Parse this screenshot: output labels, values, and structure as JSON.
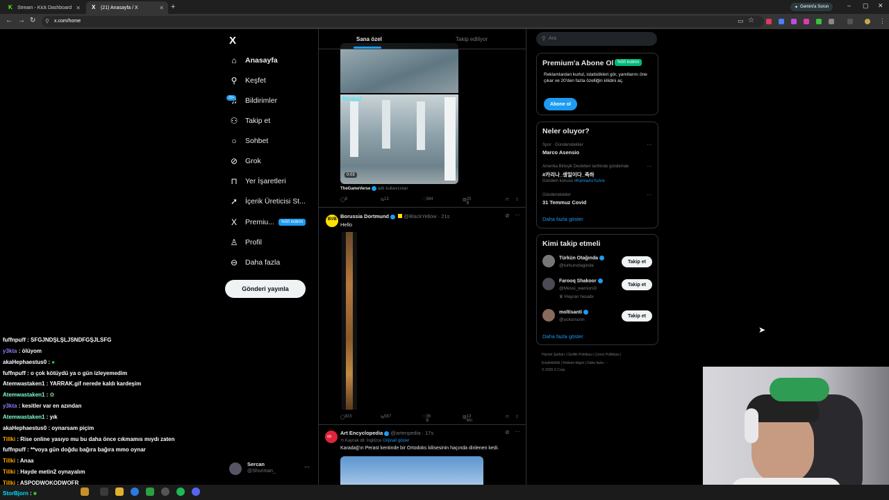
{
  "browser": {
    "tabs": [
      {
        "title": "Stream - Kick Dashboard",
        "favicon": "kick-logo-icon"
      },
      {
        "title": "(21) Anasayfa / X",
        "favicon": "x-logo-icon"
      }
    ],
    "url": "x.com/home",
    "gemini_label": "Gemini'a Sorun"
  },
  "left_nav": {
    "logo": "X",
    "items": [
      {
        "label": "Anasayfa",
        "icon": "home-icon"
      },
      {
        "label": "Keşfet",
        "icon": "search-icon"
      },
      {
        "label": "Bildirimler",
        "icon": "bell-icon",
        "badge": "20+"
      },
      {
        "label": "Takip et",
        "icon": "add-person-icon"
      },
      {
        "label": "Sohbet",
        "icon": "chat-icon"
      },
      {
        "label": "Grok",
        "icon": "grok-icon"
      },
      {
        "label": "Yer İşaretleri",
        "icon": "bookmark-icon"
      },
      {
        "label": "İçerik Üreticisi St...",
        "icon": "rocket-icon"
      },
      {
        "label": "Premiu...",
        "icon": "x-premium-icon",
        "badge": "%50 indirim"
      },
      {
        "label": "Profil",
        "icon": "person-icon"
      },
      {
        "label": "Daha fazla",
        "icon": "more-circle-icon"
      }
    ],
    "post_button": "Gönderi yayınla",
    "profile": {
      "name": "Sercan",
      "handle": "@Shuriman_",
      "more": "···"
    }
  },
  "chat": [
    {
      "user": "fuffnpuff",
      "msg": "SFGJNDŞLŞLJSNDFGŞJLSFG",
      "color": "#ffffff"
    },
    {
      "user": "y3kta",
      "msg": "ölüyom",
      "color": "#8a7dff"
    },
    {
      "user": "akaHephaestus0",
      "msg": "",
      "color": "#ffffff"
    },
    {
      "user": "fuffnpuff",
      "msg": "o çok kötüydü ya o gün izleyemedim",
      "color": "#ffffff"
    },
    {
      "user": "Atemwastaken1",
      "msg": "YARRAK.gif nerede kaldı kardeşim",
      "color": "#ffffff"
    },
    {
      "user": "Atemwastaken1",
      "msg": "",
      "color": "#7fffd4"
    },
    {
      "user": "y3kta",
      "msg": "kesitler var en azından",
      "color": "#8a7dff"
    },
    {
      "user": "Atemwastaken1",
      "msg": "yık",
      "color": "#7fffd4"
    },
    {
      "user": "akaHephaestus0",
      "msg": "oynarsam piçim",
      "color": "#ffffff"
    },
    {
      "user": "Tillki",
      "msg": "Rise online yasıyo mu bu daha önce cıkmamıs mıydı zaten",
      "color": "#ffa500"
    },
    {
      "user": "fuffnpuff",
      "msg": "**voya gün doğdu bağıra bağıra mmo oynar",
      "color": "#ffffff"
    },
    {
      "user": "Tillki",
      "msg": "Anaa",
      "color": "#ffa500"
    },
    {
      "user": "Tillki",
      "msg": "Hayde metin2 oynayalım",
      "color": "#ffa500"
    },
    {
      "user": "Tillki",
      "msg": "ASPODWQKODWQFR",
      "color": "#ffa500"
    },
    {
      "user": "StorBjorn",
      "msg": "",
      "color": "#00e0ff"
    }
  ],
  "feed": {
    "tabs": [
      "Sana özel",
      "Takip ediliyor"
    ],
    "tweet1": {
      "media_label": "Normal",
      "duration": "0:03",
      "source": "TheGameVerse",
      "source_suffix": "adlı kullanıcıdan",
      "replies": "8",
      "reposts": "13",
      "likes": "384",
      "views": "20 B"
    },
    "tweet2": {
      "name": "Borussia Dortmund",
      "handle": "@BlackYellow",
      "time": "· 21s",
      "text": "Hello",
      "replies": "815",
      "reposts": "587",
      "likes": "36 B",
      "views": "13 Mn"
    },
    "tweet3": {
      "name": "Art Encyclopedia",
      "handle": "@artenpedia",
      "time": "· 17s",
      "lang_note": "Kaynak dil: İngilizce",
      "show_original": "Orijinali göster",
      "text": "Karadağ'ın Perast kentinde bir Ortodoks kilisesinin haçında dinlenen kedi."
    }
  },
  "right": {
    "search_placeholder": "Ara",
    "premium": {
      "title": "Premium'a Abone Ol",
      "badge": "%50 indirim",
      "text": "Reklamlardan kurtul, istatistikleri gör, yanıtlarını öne çıkar ve 20'den fazla özelliğin kilidini aç.",
      "button": "Abone ol"
    },
    "trends": {
      "title": "Neler oluyor?",
      "items": [
        {
          "context": "Spor · Gündemdekiler",
          "name": "Marco Asensio",
          "extra": ""
        },
        {
          "context": "Amerika Birleşik Devletleri tarihinde gündemde",
          "name": "#카리나_생일이다_축하",
          "extra_prefix": "Gündem konusu",
          "extra": "#KarinaAsYuAre"
        },
        {
          "context": "Gündemdekiler",
          "name": "31 Temmuz Covid",
          "extra": ""
        }
      ],
      "more": "Daha fazla göster"
    },
    "who_to_follow": {
      "title": "Kimi takip etmeli",
      "items": [
        {
          "name": "Türkün Otağında",
          "handle": "@turkunotaginda",
          "note": ""
        },
        {
          "name": "Farooq Shakoor",
          "handle": "@Messi_warriors9",
          "note": "Hayran hesabı"
        },
        {
          "name": "moltisanti",
          "handle": "@uckursunn",
          "note": ""
        }
      ],
      "button": "Takip et",
      "more": "Daha fazla göster"
    },
    "footer": {
      "line1": [
        "Hizmet Şartları",
        "Gizlilik Politikası",
        "Çerez Politikası"
      ],
      "line2": [
        "Erişilebilirlik",
        "Reklam bilgisi",
        "Daha fazla ···"
      ],
      "copyright": "© 2025 X Corp."
    }
  },
  "colors": {
    "accent": "#1d9bf0",
    "bg": "#000000",
    "border": "#2f3336",
    "muted": "#71767b"
  }
}
